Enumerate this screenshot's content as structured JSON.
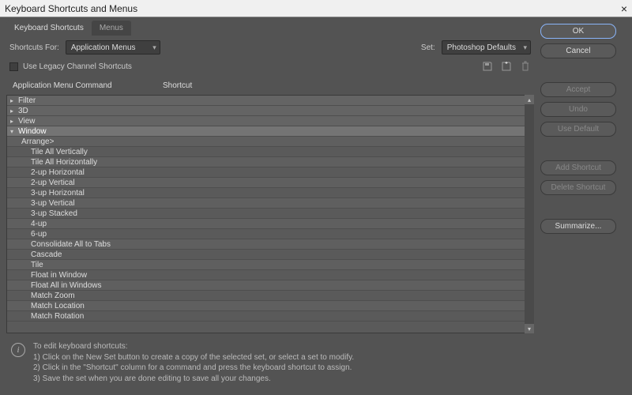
{
  "window": {
    "title": "Keyboard Shortcuts and Menus"
  },
  "tabs": {
    "shortcuts": "Keyboard Shortcuts",
    "menus": "Menus"
  },
  "controls": {
    "shortcuts_for_label": "Shortcuts For:",
    "shortcuts_for_value": "Application Menus",
    "set_label": "Set:",
    "set_value": "Photoshop Defaults",
    "legacy_label": "Use Legacy Channel Shortcuts"
  },
  "columns": {
    "command": "Application Menu Command",
    "shortcut": "Shortcut"
  },
  "sections": [
    {
      "label": "Filter",
      "expanded": false
    },
    {
      "label": "3D",
      "expanded": false
    },
    {
      "label": "View",
      "expanded": false
    },
    {
      "label": "Window",
      "expanded": true,
      "selected": true
    }
  ],
  "window_items": {
    "arrange_label": "Arrange>",
    "children": [
      "Tile All Vertically",
      "Tile All Horizontally",
      "2-up Horizontal",
      "2-up Vertical",
      "3-up Horizontal",
      "3-up Vertical",
      "3-up Stacked",
      "4-up",
      "6-up",
      "Consolidate All to Tabs",
      "Cascade",
      "Tile",
      "Float in Window",
      "Float All in Windows",
      "Match Zoom",
      "Match Location",
      "Match Rotation"
    ]
  },
  "help": {
    "title": "To edit keyboard shortcuts:",
    "line1": "1) Click on the New Set button to create a copy of the selected set, or select a set to modify.",
    "line2": "2) Click in the \"Shortcut\" column for a command and press the keyboard shortcut to assign.",
    "line3": "3) Save the set when you are done editing to save all your changes."
  },
  "buttons": {
    "ok": "OK",
    "cancel": "Cancel",
    "accept": "Accept",
    "undo": "Undo",
    "use_default": "Use Default",
    "add_shortcut": "Add Shortcut",
    "delete_shortcut": "Delete Shortcut",
    "summarize": "Summarize..."
  }
}
